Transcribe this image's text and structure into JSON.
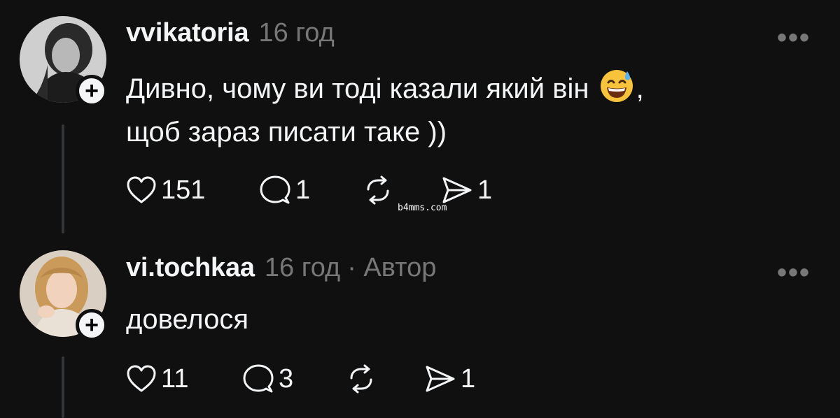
{
  "posts": [
    {
      "username": "vvikatoria",
      "time": "16 год",
      "author_tag": "",
      "text_line1": "Дивно, чому ви тоді казали який він",
      "emoji": "grinning-face-with-sweat",
      "text_line1_suffix": ",",
      "text_line2": "щоб зараз писати таке ))",
      "likes": "151",
      "replies": "1",
      "reposts": "",
      "shares": "1"
    },
    {
      "username": "vi.tochkaa",
      "time": "16 год",
      "author_tag": "· Автор",
      "text_line1": "довелося",
      "likes": "11",
      "replies": "3",
      "reposts": "",
      "shares": "1"
    }
  ],
  "more_label": "•••",
  "watermark": "b4mms.com",
  "icons": [
    "heart-icon",
    "comment-icon",
    "repost-icon",
    "share-icon",
    "more-icon",
    "follow-plus-icon"
  ],
  "colors": {
    "background": "#101010",
    "text": "#f3f5f7",
    "muted": "#777777",
    "thread_line": "#333638"
  }
}
